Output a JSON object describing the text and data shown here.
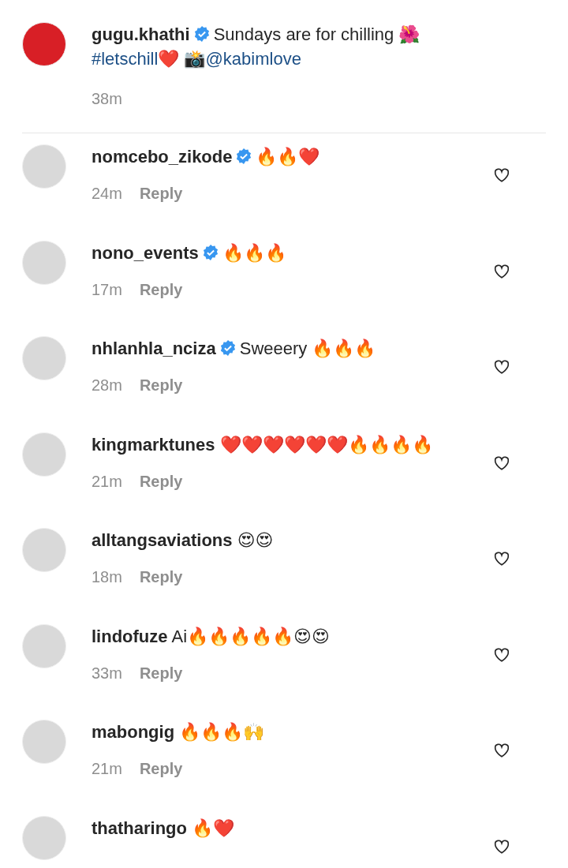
{
  "caption": {
    "username": "gugu.khathi",
    "verified": true,
    "parts": [
      {
        "kind": "text",
        "text": "Sundays are for chilling 🌺"
      },
      {
        "kind": "link",
        "text": "#letschill"
      },
      {
        "kind": "text",
        "text": "❤️ 📸"
      },
      {
        "kind": "link",
        "text": "@kabimlove"
      }
    ],
    "time": "38m"
  },
  "comments": [
    {
      "username": "nomcebo_zikode",
      "verified": true,
      "text": "🔥🔥❤️",
      "time": "24m",
      "reply": "Reply",
      "liked": false
    },
    {
      "username": "nono_events",
      "verified": true,
      "text": "🔥🔥🔥",
      "time": "17m",
      "reply": "Reply",
      "liked": false
    },
    {
      "username": "nhlanhla_nciza",
      "verified": true,
      "text": "Sweeery 🔥🔥🔥",
      "time": "28m",
      "reply": "Reply",
      "liked": false
    },
    {
      "username": "kingmarktunes",
      "verified": false,
      "text": "❤️❤️❤️❤️❤️❤️🔥🔥🔥🔥",
      "time": "21m",
      "reply": "Reply",
      "liked": false
    },
    {
      "username": "alltangsaviations",
      "verified": false,
      "text": "😍😍",
      "time": "18m",
      "reply": "Reply",
      "liked": false
    },
    {
      "username": "lindofuze",
      "verified": false,
      "text": "Ai🔥🔥🔥🔥🔥😍😍",
      "time": "33m",
      "reply": "Reply",
      "liked": false
    },
    {
      "username": "mabongig",
      "verified": false,
      "text": "🔥🔥🔥🙌",
      "time": "21m",
      "reply": "Reply",
      "liked": false
    },
    {
      "username": "thatharingo",
      "verified": false,
      "text": "🔥❤️",
      "liked": false
    }
  ]
}
